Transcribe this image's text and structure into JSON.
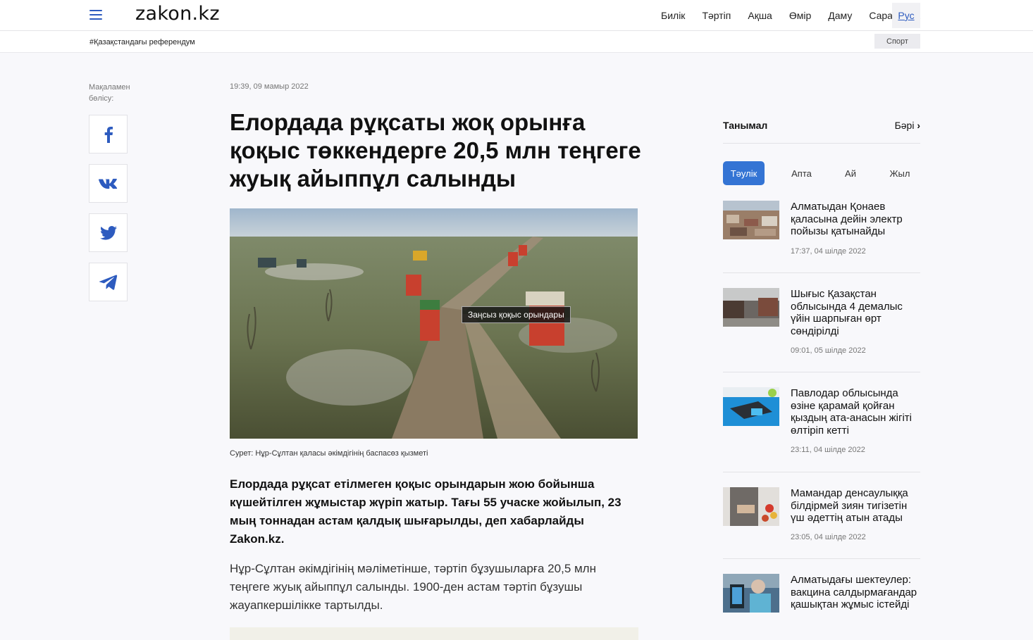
{
  "header": {
    "logo": "zakon.kz",
    "nav": [
      "Билік",
      "Тәртіп",
      "Ақша",
      "Өмір",
      "Даму",
      "Сараптама"
    ],
    "lang": "Рус"
  },
  "subbar": {
    "tag": "#Қазақстандағы референдум",
    "sport": "Спорт"
  },
  "share": {
    "label": "Мақаламен бөлісу:",
    "icons": [
      "facebook-icon",
      "vk-icon",
      "twitter-icon",
      "telegram-icon"
    ]
  },
  "article": {
    "date": "19:39, 09 мамыр 2022",
    "title": "Елордада рұқсаты жоқ орынға қоқыс төккендерге 20,5 млн теңгеге жуық айыппұл салынды",
    "photo_overlay": "Заңсыз қоқыс орындары",
    "caption": "Сурет: Нұр-Сұлтан қаласы әкімдігінің баспасөз қызметі",
    "lead": "Елордада рұқсат етілмеген қоқыс орындарын жою бойынша күшейтілген жұмыстар жүріп жатыр. Тағы 55 учаске жойылып, 23 мың тоннадан астам қалдық шығарылды, деп хабарлайды Zakon.kz.",
    "body": "Нұр-Сұлтан әкімдігінің мәліметінше, тәртіп бұзушыларға 20,5 млн теңгеге жуық айыппұл салынды. 1900-ден астам тәртіп бұзушы жауапкершілікке тартылды."
  },
  "sidebar": {
    "title": "Танымал",
    "all": "Бәрі",
    "tabs": [
      "Тәулік",
      "Апта",
      "Ай",
      "Жыл"
    ],
    "news": [
      {
        "title": "Алматыдан Қонаев қаласына дейін электр пойызы қатынайды",
        "date": "17:37, 04 шілде 2022"
      },
      {
        "title": "Шығыс Қазақстан облысында 4 демалыс үйін шарпыған өрт сөндірілді",
        "date": "09:01, 05 шілде 2022"
      },
      {
        "title": "Павлодар облысында өзіне қарамай қойған қыздың ата-анасын жігіті өлтіріп кетті",
        "date": "23:11, 04 шілде 2022"
      },
      {
        "title": "Мамандар денсаулыққа білдірмей зиян тигізетін үш әдеттің атын атады",
        "date": "23:05, 04 шілде 2022"
      },
      {
        "title": "Алматыдағы шектеулер: вакцина салдырмағандар қашықтан жұмыс істейді",
        "date": ""
      }
    ]
  },
  "colors": {
    "accent": "#3474d4",
    "link": "#2d5bbf"
  }
}
